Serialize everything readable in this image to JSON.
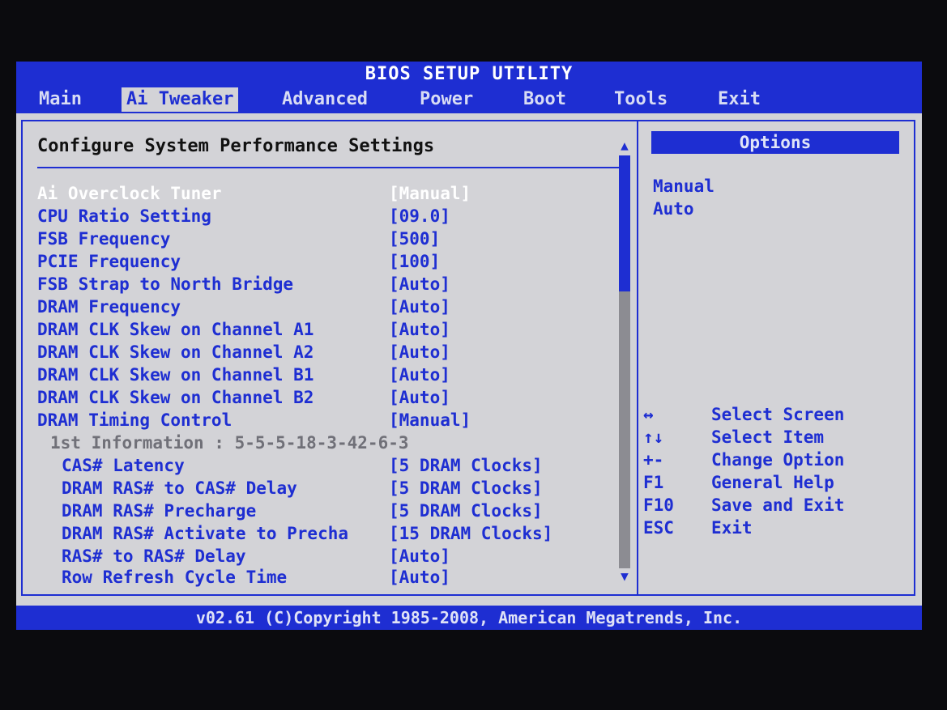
{
  "title": "BIOS SETUP UTILITY",
  "menu": [
    {
      "label": "Main",
      "active": false
    },
    {
      "label": "Ai Tweaker",
      "active": true
    },
    {
      "label": "Advanced",
      "active": false
    },
    {
      "label": "Power",
      "active": false
    },
    {
      "label": "Boot",
      "active": false
    },
    {
      "label": "Tools",
      "active": false
    },
    {
      "label": "Exit",
      "active": false
    }
  ],
  "section_title": "Configure System Performance Settings",
  "settings": [
    {
      "label": "Ai Overclock Tuner",
      "value": "[Manual]",
      "state": "selected"
    },
    {
      "label": "CPU Ratio Setting",
      "value": "[09.0]",
      "state": "normal"
    },
    {
      "label": "FSB Frequency",
      "value": "[500]",
      "state": "normal"
    },
    {
      "label": "PCIE Frequency",
      "value": "[100]",
      "state": "normal"
    },
    {
      "label": "FSB Strap to North Bridge",
      "value": "[Auto]",
      "state": "normal"
    },
    {
      "label": "DRAM Frequency",
      "value": "[Auto]",
      "state": "normal"
    },
    {
      "label": "DRAM CLK Skew on Channel A1",
      "value": "[Auto]",
      "state": "normal"
    },
    {
      "label": "DRAM CLK Skew on Channel A2",
      "value": "[Auto]",
      "state": "normal"
    },
    {
      "label": "DRAM CLK Skew on Channel B1",
      "value": "[Auto]",
      "state": "normal"
    },
    {
      "label": "DRAM CLK Skew on Channel B2",
      "value": "[Auto]",
      "state": "normal"
    },
    {
      "label": "DRAM Timing Control",
      "value": "[Manual]",
      "state": "normal"
    },
    {
      "label": "1st Information : 5-5-5-18-3-42-6-3",
      "value": "",
      "state": "info"
    },
    {
      "label": "CAS# Latency",
      "value": "[5 DRAM Clocks]",
      "state": "normal"
    },
    {
      "label": "DRAM RAS# to CAS# Delay",
      "value": "[5 DRAM Clocks]",
      "state": "normal"
    },
    {
      "label": "DRAM RAS# Precharge",
      "value": "[5 DRAM Clocks]",
      "state": "normal"
    },
    {
      "label": "DRAM RAS# Activate to Precha",
      "value": "[15 DRAM Clocks]",
      "state": "normal"
    },
    {
      "label": "RAS# to RAS# Delay",
      "value": "[Auto]",
      "state": "normal"
    },
    {
      "label": "Row Refresh Cycle Time",
      "value": "[Auto]",
      "state": "normal"
    }
  ],
  "scrollbar": {
    "up_icon": "▲",
    "down_icon": "▼"
  },
  "options": {
    "header": "Options",
    "items": [
      "Manual",
      "Auto"
    ]
  },
  "help": [
    {
      "key": "↔",
      "action": "Select Screen",
      "icon": "left-right-arrow-icon"
    },
    {
      "key": "↑↓",
      "action": "Select Item",
      "icon": "up-down-arrow-icon"
    },
    {
      "key": "+-",
      "action": "Change Option",
      "icon": "plus-minus-icon"
    },
    {
      "key": "F1",
      "action": "General Help"
    },
    {
      "key": "F10",
      "action": "Save and Exit"
    },
    {
      "key": "ESC",
      "action": "Exit"
    }
  ],
  "footer": "v02.61 (C)Copyright 1985-2008, American Megatrends, Inc.",
  "colors": {
    "blue": "#1e2ed2",
    "panel": "#d3d3d7",
    "highlight": "#ffffff",
    "info": "#707078"
  }
}
